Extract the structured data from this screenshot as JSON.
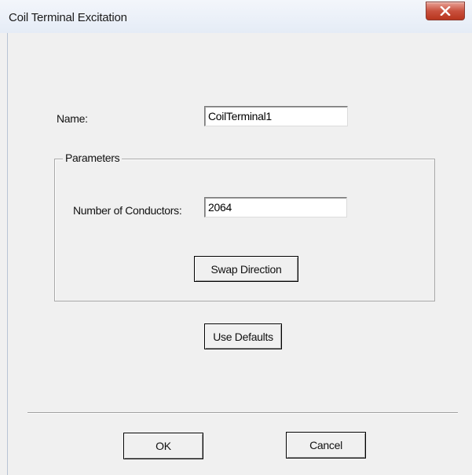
{
  "window": {
    "title": "Coil Terminal Excitation",
    "close_symbol": "x",
    "close_icon": "close-icon"
  },
  "form": {
    "name_label": "Name:",
    "name_value": "CoilTerminal1",
    "parameters_group_title": "Parameters",
    "conductors_label": "Number of Conductors:",
    "conductors_value": "2064",
    "swap_direction_label": "Swap Direction",
    "use_defaults_label": "Use Defaults"
  },
  "footer": {
    "ok_label": "OK",
    "cancel_label": "Cancel"
  },
  "colors": {
    "dialog_bg": "#f0f0f0",
    "close_button": "#c9513e",
    "titlebar": "#e9eef6"
  }
}
